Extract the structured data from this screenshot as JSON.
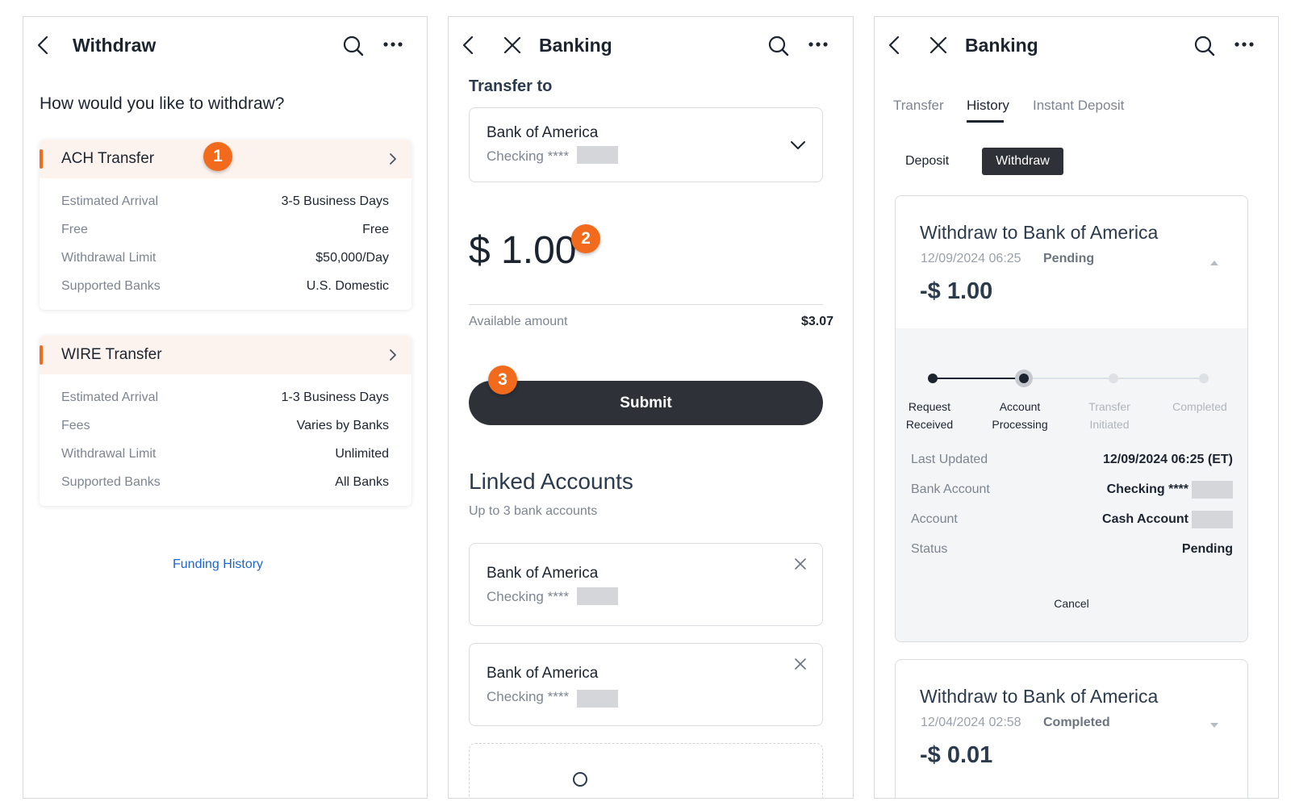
{
  "withdraw_screen": {
    "title": "Withdraw",
    "question": "How would you like to withdraw?",
    "methods": [
      {
        "name": "ACH Transfer",
        "rows": [
          {
            "label": "Estimated Arrival",
            "value": "3-5 Business Days"
          },
          {
            "label": "Free",
            "value": "Free"
          },
          {
            "label": "Withdrawal Limit",
            "value": "$50,000/Day"
          },
          {
            "label": "Supported Banks",
            "value": "U.S. Domestic"
          }
        ]
      },
      {
        "name": "WIRE Transfer",
        "rows": [
          {
            "label": "Estimated Arrival",
            "value": "1-3 Business Days"
          },
          {
            "label": "Fees",
            "value": "Varies by Banks"
          },
          {
            "label": "Withdrawal Limit",
            "value": "Unlimited"
          },
          {
            "label": "Supported Banks",
            "value": "All Banks"
          }
        ]
      }
    ],
    "funding_history_link": "Funding History"
  },
  "transfer_screen": {
    "title": "Banking",
    "transfer_to_label": "Transfer to",
    "selected_account": {
      "bank": "Bank of America",
      "type": "Checking ****"
    },
    "amount": "$ 1.00",
    "available_label": "Available amount",
    "available_value": "$3.07",
    "submit_label": "Submit",
    "linked_title": "Linked Accounts",
    "linked_subtitle": "Up to 3 bank accounts",
    "linked_accounts": [
      {
        "bank": "Bank of America",
        "type": "Checking ****"
      },
      {
        "bank": "Bank of America",
        "type": "Checking ****"
      }
    ]
  },
  "history_screen": {
    "title": "Banking",
    "tabs": [
      "Transfer",
      "History",
      "Instant Deposit"
    ],
    "active_tab": "History",
    "segments": {
      "deposit": "Deposit",
      "withdraw": "Withdraw"
    },
    "records": [
      {
        "title": "Withdraw to Bank of America",
        "date": "12/09/2024 06:25",
        "status": "Pending",
        "amount": "-$ 1.00",
        "steps": [
          {
            "line1": "Request",
            "line2": "Received"
          },
          {
            "line1": "Account",
            "line2": "Processing"
          },
          {
            "line1": "Transfer",
            "line2": "Initiated"
          },
          {
            "line1": "Completed",
            "line2": ""
          }
        ],
        "current_step": 2,
        "details": [
          {
            "label": "Last Updated",
            "value": "12/09/2024 06:25 (ET)"
          },
          {
            "label": "Bank Account",
            "value": "Checking ****"
          },
          {
            "label": "Account",
            "value": "Cash Account"
          },
          {
            "label": "Status",
            "value": "Pending"
          }
        ],
        "cancel_label": "Cancel"
      },
      {
        "title": "Withdraw to Bank of America",
        "date": "12/04/2024 02:58",
        "status": "Completed",
        "amount": "-$ 0.01"
      }
    ]
  },
  "annotations": [
    "1",
    "2",
    "3"
  ],
  "colors": {
    "accent_orange": "#f26a1b",
    "link_blue": "#1b66d1",
    "dark_button": "#2e3238",
    "card_header_tint": "#fdf3ee"
  }
}
